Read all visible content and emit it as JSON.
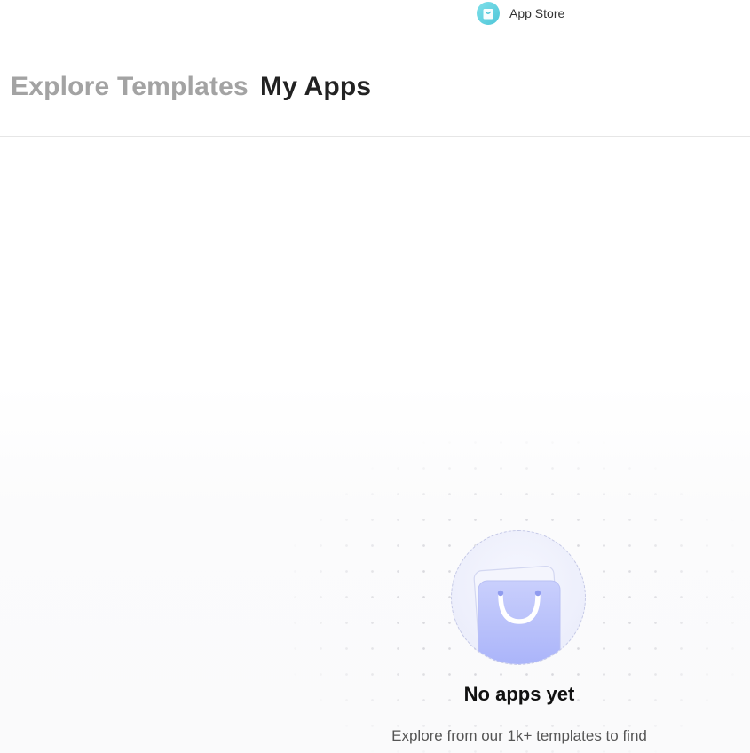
{
  "topbar": {
    "app_store_label": "App Store",
    "app_store_icon": "shopping-bag-icon",
    "app_store_icon_color": "#5cccdc"
  },
  "tabs": [
    {
      "label": "Explore Templates",
      "active": false
    },
    {
      "label": "My Apps",
      "active": true
    }
  ],
  "empty_state": {
    "icon": "shopping-bag-icon",
    "title": "No apps yet",
    "subtitle": "Explore from our 1k+ templates to find",
    "accent_color": "#b4bdfa"
  }
}
